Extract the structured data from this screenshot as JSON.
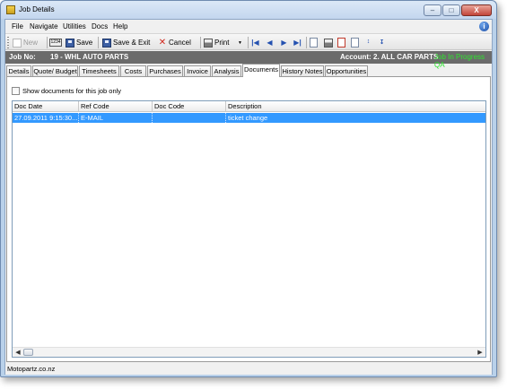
{
  "window": {
    "title": "Job Details",
    "minimize": "–",
    "maximize": "□",
    "close": "X"
  },
  "menu": {
    "items": [
      "File",
      "Navigate",
      "Utilities",
      "Docs",
      "Help"
    ],
    "help_icon": "i"
  },
  "toolbar": {
    "new_label": "New",
    "save_label": "Save",
    "save_exit_label": "Save & Exit",
    "cancel_label": "Cancel",
    "print_label": "Print",
    "print_dropdown": "▼",
    "calc_icon": "1234",
    "nav": [
      "|◀",
      "◀",
      "▶",
      "▶|"
    ]
  },
  "job": {
    "job_no_label": "Job No:",
    "job_no_value": "19 - WHL AUTO PARTS",
    "account_label": "Account:",
    "account_value": "2. ALL CAR PARTS",
    "status_value": "Job In Progress QA",
    "status_color": "#00cc00"
  },
  "tabs": [
    "Details",
    "Quote/ Budget",
    "Timesheets",
    "Costs",
    "Purchases",
    "Invoice",
    "Analysis",
    "Documents",
    "History Notes",
    "Opportunities"
  ],
  "active_tab": "Documents",
  "documents": {
    "show_only_label": "Show documents for this job only",
    "show_only_checked": false,
    "columns": [
      "Doc Date",
      "Ref Code",
      "Doc Code",
      "Description"
    ],
    "rows": [
      {
        "doc_date": "27.09.2011 9:15:30...",
        "ref_code": "E-MAIL",
        "doc_code": "",
        "description": "ticket change",
        "selected": true
      }
    ],
    "scroll_left": "◀",
    "scroll_right": "▶"
  },
  "statusbar": {
    "text": "Motopartz.co.nz"
  },
  "colors": {
    "selection": "#3399ff",
    "header_band": "#6b6b6b"
  }
}
